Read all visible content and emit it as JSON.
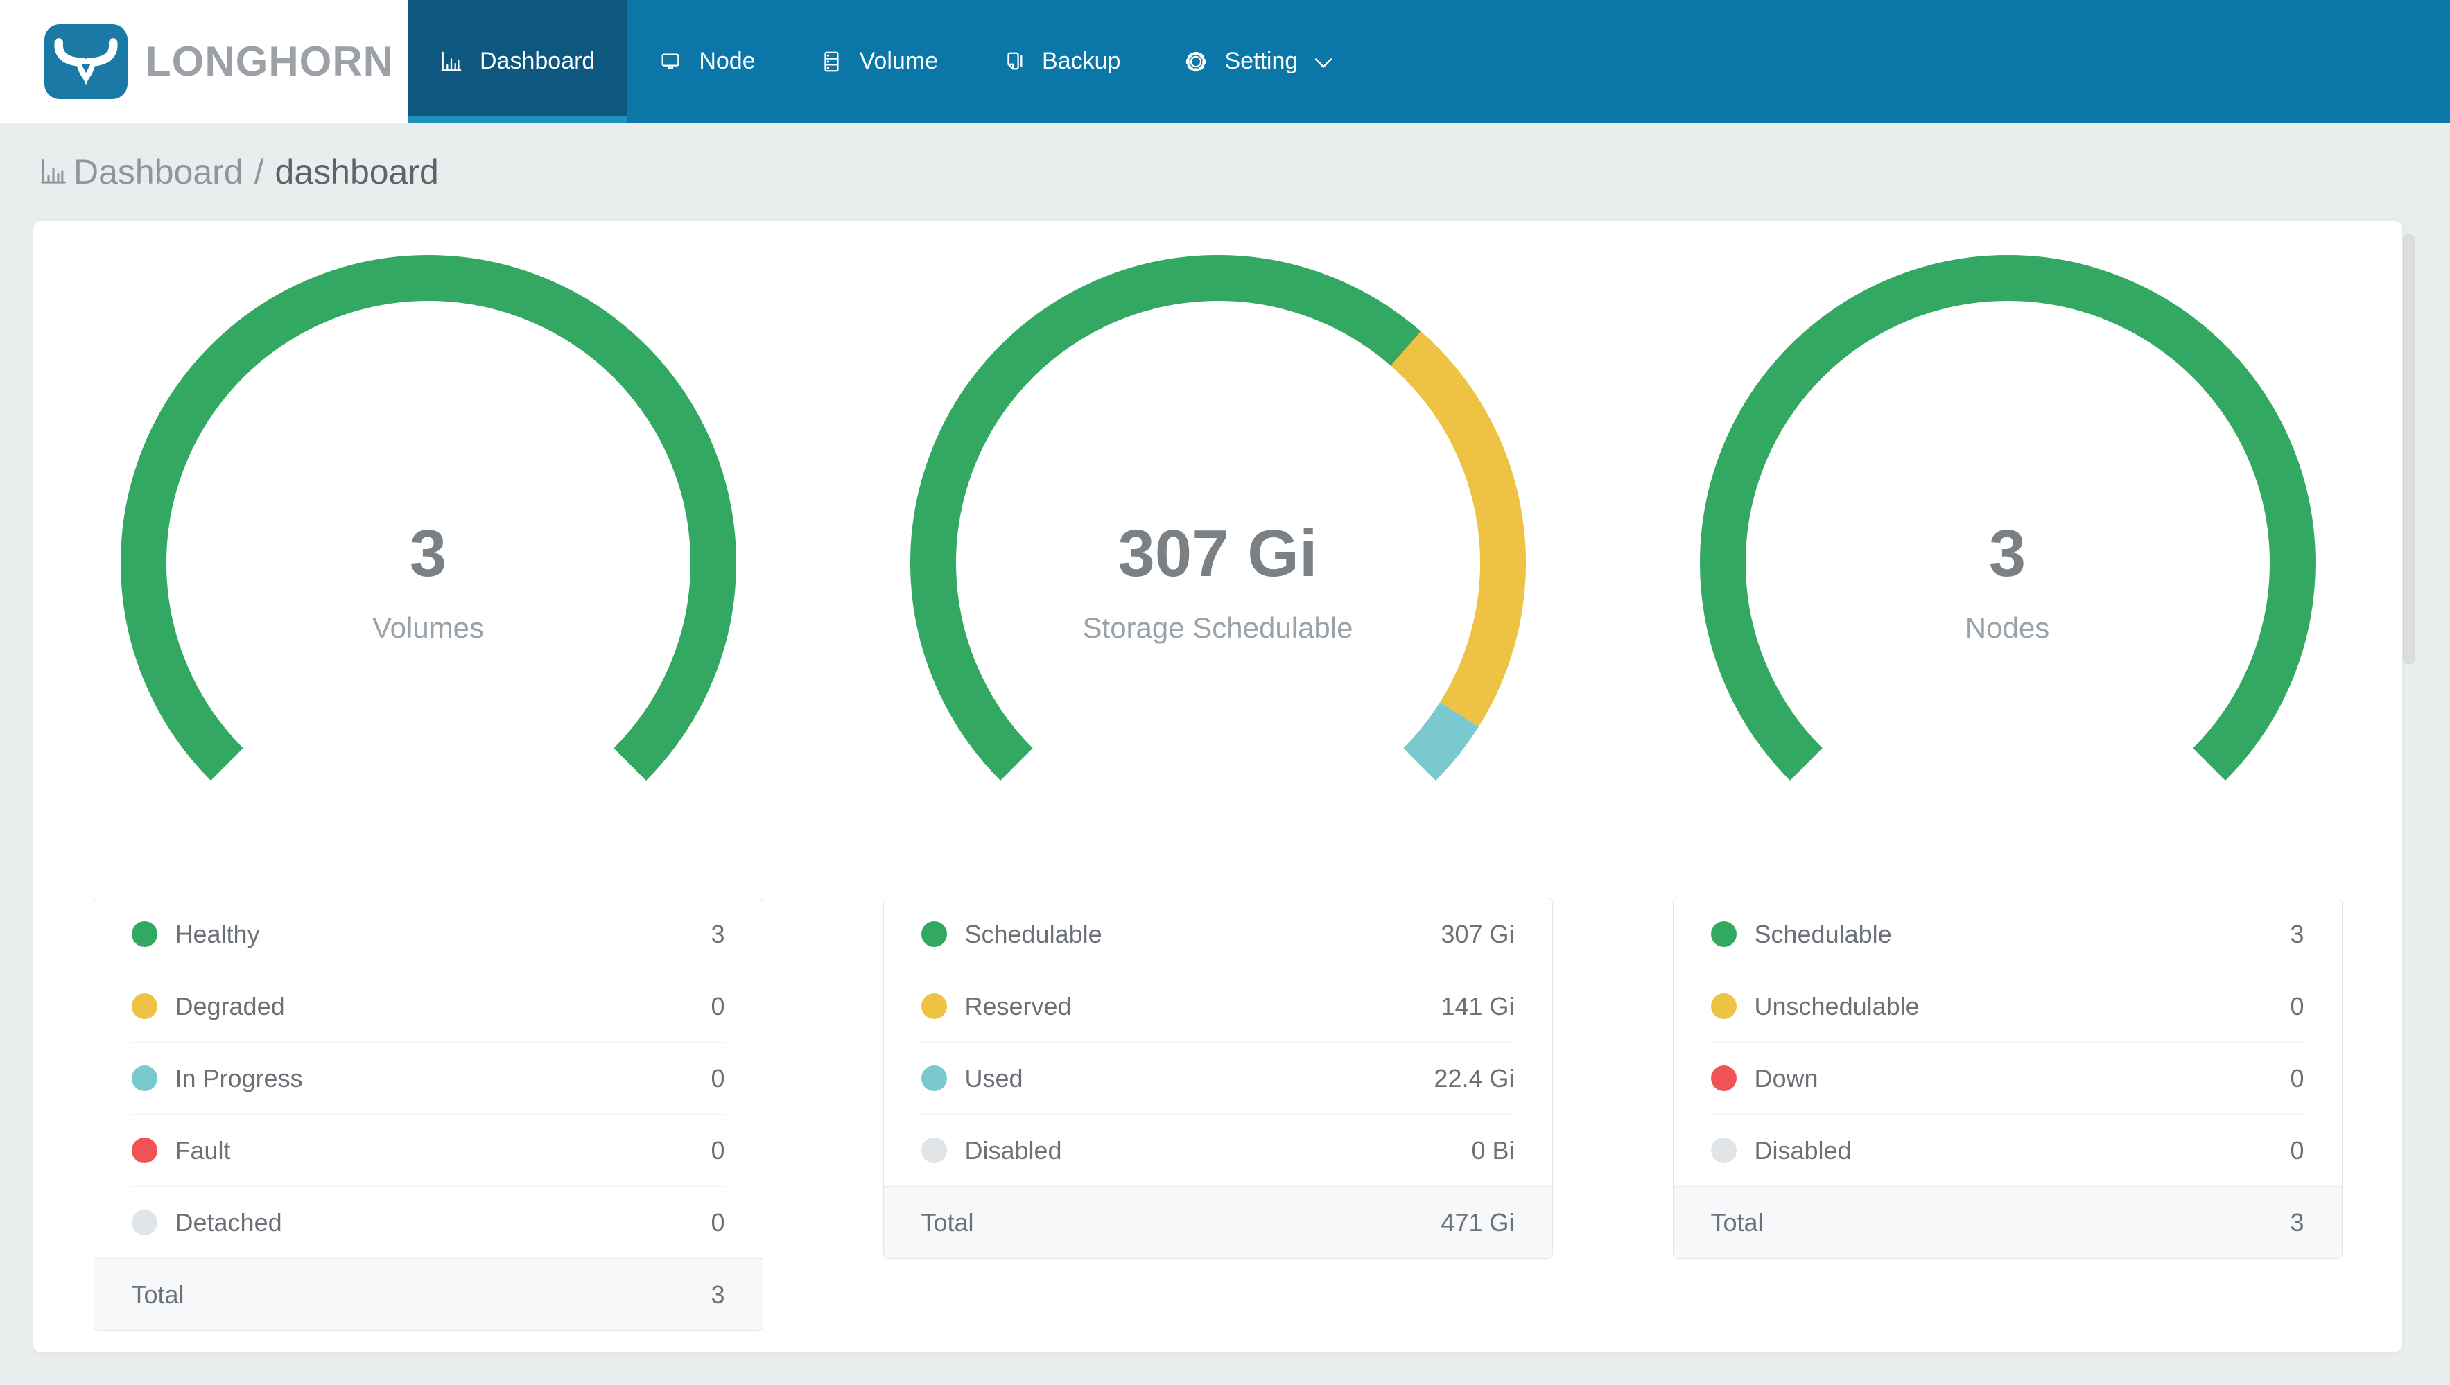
{
  "header": {
    "logo_text": "LONGHORN",
    "nav": {
      "items": [
        {
          "label": "Dashboard",
          "icon": "bar-chart-icon",
          "active": true
        },
        {
          "label": "Node",
          "icon": "node-icon",
          "active": false
        },
        {
          "label": "Volume",
          "icon": "volume-icon",
          "active": false
        },
        {
          "label": "Backup",
          "icon": "backup-icon",
          "active": false
        },
        {
          "label": "Setting",
          "icon": "gear-icon",
          "active": false,
          "has_dropdown": true
        }
      ]
    }
  },
  "breadcrumb": {
    "icon": "bar-chart-icon",
    "section": "Dashboard",
    "separator": "/",
    "current": "dashboard"
  },
  "colors": {
    "navbar": "#0b76a8",
    "navbar_active": "#0e587f",
    "navbar_active_underline": "#1f93be",
    "logo_badge": "#1b7aa5",
    "page_background": "#e9edee",
    "green": "#32a862",
    "yellow": "#eec243",
    "teal": "#79c9ce",
    "red": "#ef5355",
    "gray": "#e2e5e7"
  },
  "chart_data": [
    {
      "type": "gauge",
      "start_angle": 225,
      "sweep": 270,
      "center_value": "3",
      "center_label": "Volumes",
      "segments": [
        {
          "label": "Healthy",
          "value": 3,
          "display": "3",
          "color": "#32a862"
        },
        {
          "label": "Degraded",
          "value": 0,
          "display": "0",
          "color": "#eec243"
        },
        {
          "label": "In Progress",
          "value": 0,
          "display": "0",
          "color": "#79c9ce"
        },
        {
          "label": "Fault",
          "value": 0,
          "display": "0",
          "color": "#ef5355"
        },
        {
          "label": "Detached",
          "value": 0,
          "display": "0",
          "color": "#e2e5e7"
        }
      ],
      "total": {
        "label": "Total",
        "display": "3"
      }
    },
    {
      "type": "gauge",
      "start_angle": 225,
      "sweep": 270,
      "center_value": "307 Gi",
      "center_label": "Storage Schedulable",
      "segments": [
        {
          "label": "Schedulable",
          "value": 307,
          "display": "307 Gi",
          "color": "#32a862"
        },
        {
          "label": "Reserved",
          "value": 141,
          "display": "141 Gi",
          "color": "#eec243"
        },
        {
          "label": "Used",
          "value": 22.4,
          "display": "22.4 Gi",
          "color": "#79c9ce"
        },
        {
          "label": "Disabled",
          "value": 0,
          "display": "0 Bi",
          "color": "#e2e5e7"
        }
      ],
      "total": {
        "label": "Total",
        "display": "471 Gi"
      }
    },
    {
      "type": "gauge",
      "start_angle": 225,
      "sweep": 270,
      "center_value": "3",
      "center_label": "Nodes",
      "segments": [
        {
          "label": "Schedulable",
          "value": 3,
          "display": "3",
          "color": "#32a862"
        },
        {
          "label": "Unschedulable",
          "value": 0,
          "display": "0",
          "color": "#eec243"
        },
        {
          "label": "Down",
          "value": 0,
          "display": "0",
          "color": "#ef5355"
        },
        {
          "label": "Disabled",
          "value": 0,
          "display": "0",
          "color": "#e2e5e7"
        }
      ],
      "total": {
        "label": "Total",
        "display": "3"
      }
    }
  ]
}
